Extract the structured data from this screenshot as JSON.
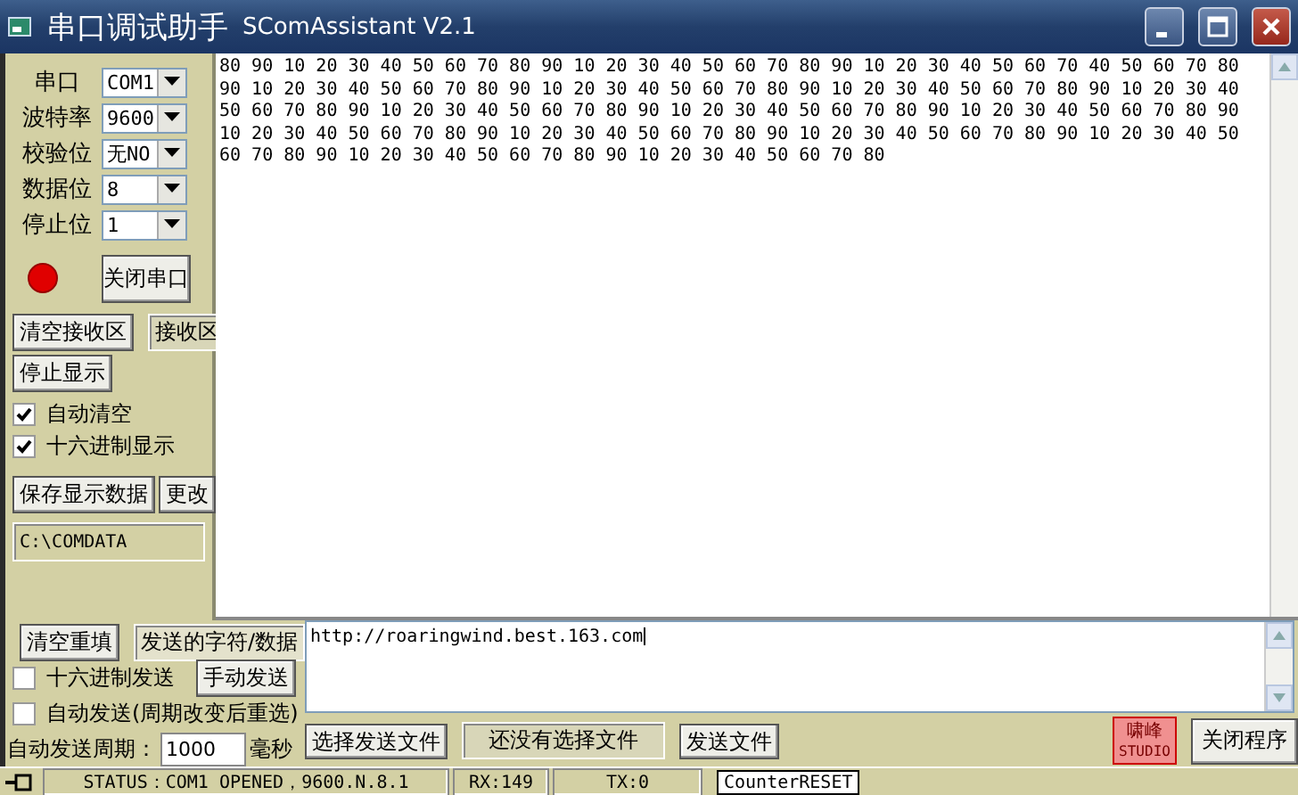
{
  "window": {
    "title": "串口调试助手",
    "subtitle": "SComAssistant V2.1"
  },
  "settings": [
    {
      "label": "串口",
      "value": "COM1"
    },
    {
      "label": "波特率",
      "value": "9600"
    },
    {
      "label": "校验位",
      "value": "无NO"
    },
    {
      "label": "数据位",
      "value": "8"
    },
    {
      "label": "停止位",
      "value": "1"
    }
  ],
  "port_led": {
    "on": true
  },
  "open_button": "关闭串口",
  "clear_receive_button": "清空接收区",
  "receive_label": "接收区",
  "stop_display_button": "停止显示",
  "options": [
    {
      "label": "自动清空",
      "checked": true
    },
    {
      "label": "十六进制显示",
      "checked": true
    }
  ],
  "save_button": "保存显示数据",
  "change_button": "更改",
  "save_path": "C:\\COMDATA",
  "received_lines": [
    "80 90 10 20 30 40 50 60 70 80 90 10 20 30 40 50 60 70 80 90 10 20 30 40 50 60 70 40 50 60 70 80",
    "90 10 20 30 40 50 60 70 80 90 10 20 30 40 50 60 70 80 90 10 20 30 40 50 60 70 80 90 10 20 30 40",
    "50 60 70 80 90 10 20 30 40 50 60 70 80 90 10 20 30 40 50 60 70 80 90 10 20 30 40 50 60 70 80 90",
    "10 20 30 40 50 60 70 80 90 10 20 30 40 50 60 70 80 90 10 20 30 40 50 60 70 80 90 10 20 30 40 50",
    "60 70 80 90 10 20 30 40 50 60 70 80 90 10 20 30 40 50 60 70 80"
  ],
  "send": {
    "clear_button": "清空重填",
    "label": "发送的字符/数据",
    "value": "http://roaringwind.best.163.com",
    "hex_send": {
      "label": "十六进制发送",
      "checked": false
    },
    "manual_send_button": "手动发送",
    "auto_send": {
      "label": "自动发送(周期改变后重选)",
      "checked": false
    },
    "period_label": "自动发送周期：",
    "period": "1000",
    "period_unit": "毫秒",
    "choose_file_button": "选择发送文件",
    "file_status": "还没有选择文件",
    "send_file_button": "发送文件"
  },
  "logo": {
    "line1": "啸峰",
    "line2": "STUDIO"
  },
  "exit_button": "关闭程序",
  "status_bar": {
    "status": "STATUS：COM1 OPENED，9600.N.8.1",
    "rx": "RX:149",
    "tx": "TX:0",
    "reset_button": "CounterRESET"
  }
}
